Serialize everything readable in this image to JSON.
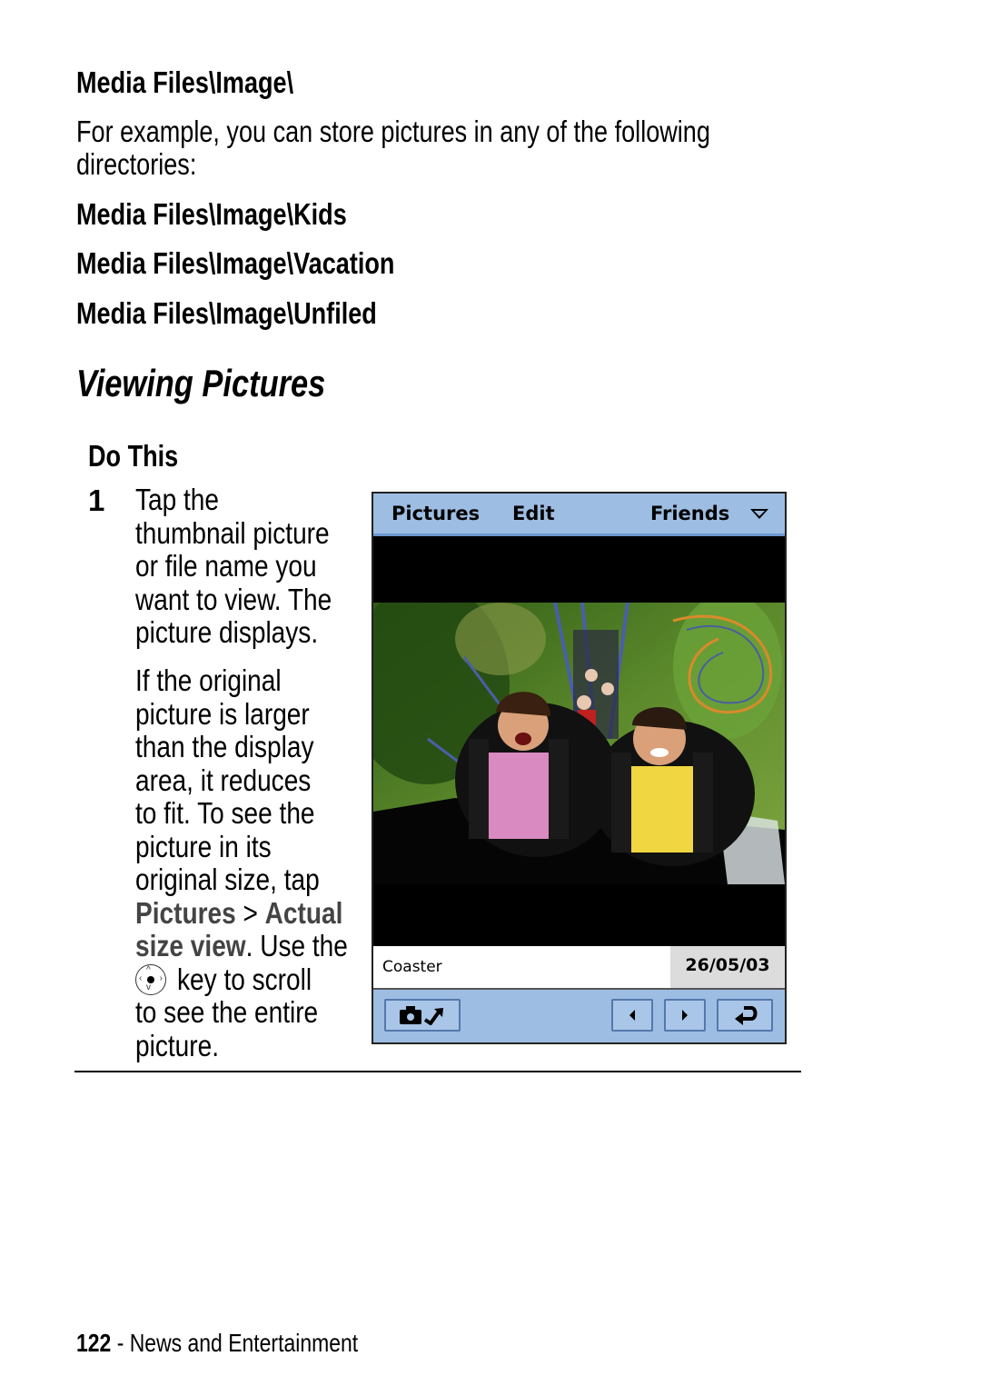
{
  "page": {
    "heading_path": "Media Files\\Image\\",
    "intro_line1": "For example, you can store pictures in any of the following",
    "intro_line2": "directories:",
    "directories": [
      "Media Files\\Image\\Kids",
      "Media Files\\Image\\Vacation",
      "Media Files\\Image\\Unfiled"
    ],
    "section_title": "Viewing Pictures",
    "do_this_label": "Do This",
    "step": {
      "number": "1",
      "lines_a": [
        "Tap the",
        "thumbnail picture",
        "or file name you",
        "want to view. The",
        "picture displays."
      ],
      "lines_b": [
        "If the original",
        "picture is larger",
        "than the display",
        "area, it reduces",
        "to fit. To see the",
        "picture in its",
        "original size, tap"
      ],
      "ref_pictures": "Pictures",
      "ref_sep": " > ",
      "ref_actual": "Actual",
      "ref_size_view": "size view",
      "after_ref": ". Use the",
      "key_text": "key to scroll",
      "lines_c": [
        "to see the entire",
        "picture."
      ]
    },
    "footer": {
      "page_number": "122",
      "section": " - News and Entertainment"
    }
  },
  "device": {
    "menu": {
      "pictures": "Pictures",
      "edit": "Edit",
      "category": "Friends"
    },
    "photo_caption": "Coaster",
    "photo_date": "26/05/03",
    "toolbar": {
      "camera_button": "camera-send",
      "prev_button": "previous",
      "next_button": "next",
      "back_button": "return"
    },
    "colors": {
      "menubar": "#9dbde2",
      "menubar_border": "#6b98cf",
      "date_bg": "#dcdcdc"
    }
  }
}
